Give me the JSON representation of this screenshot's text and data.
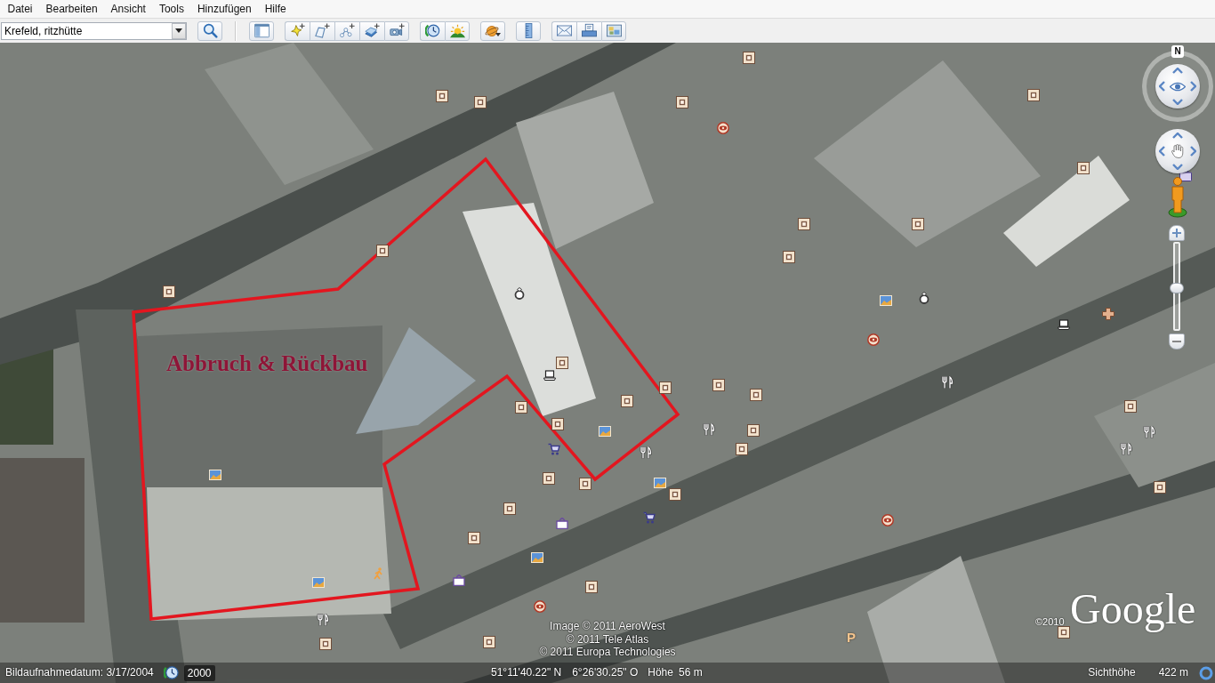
{
  "menu_bar": {
    "items": [
      "Datei",
      "Bearbeiten",
      "Ansicht",
      "Tools",
      "Hinzufügen",
      "Hilfe"
    ]
  },
  "toolbar": {
    "search": {
      "value": "Krefeld, ritzhütte"
    }
  },
  "map": {
    "polygon": {
      "label": "Abbruch & Rückbau"
    },
    "parking_sign": "P",
    "compass": {
      "north": "N"
    },
    "zoom_slider": {
      "level": 0.5
    },
    "attribution": [
      "Image © 2011 AeroWest",
      "© 2011 Tele Atlas",
      "© 2011 Europa Technologies"
    ],
    "logo": {
      "copyright": "©2010",
      "wordmark": "Google"
    }
  },
  "status_bar": {
    "imagery_date": "Bildaufnahmedatum: 3/17/2004",
    "historical_year": "2000",
    "latitude": "51°11'40.22\" N",
    "longitude": "6°26'30.25\" O",
    "elevation_label": "Höhe",
    "elevation": "56 m",
    "eye_altitude_label": "Sichthöhe",
    "eye_altitude": "422 m"
  }
}
